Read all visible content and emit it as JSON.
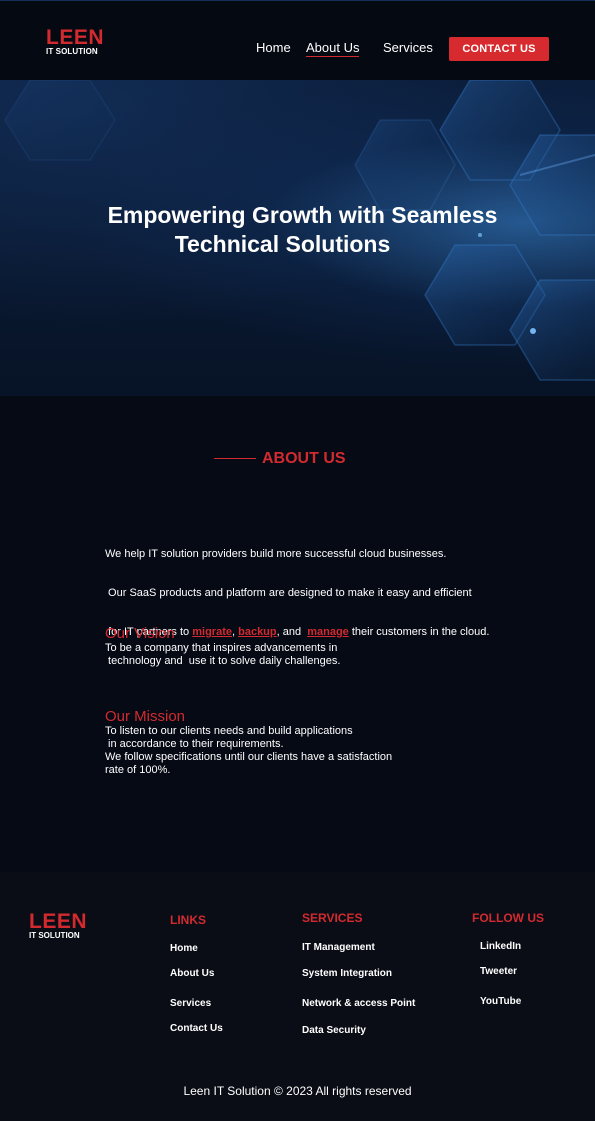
{
  "header": {
    "logo_main": "LEEN",
    "logo_sub": "IT SOLUTION",
    "nav": [
      "Home",
      "About Us",
      "Services"
    ],
    "contact_button": "CONTACT US"
  },
  "hero": {
    "title_line1": "Empowering Growth with Seamless",
    "title_line2": "Technical Solutions"
  },
  "about": {
    "heading": "ABOUT US",
    "line1": "We help IT solution providers build more successful cloud businesses.",
    "line2": " Our SaaS products and platform are designed to make it easy and efficient",
    "line3_prefix": " for IT partners to ",
    "link_migrate": "migrate",
    "sep1": ", ",
    "link_backup": "backup",
    "sep2": ", and  ",
    "link_manage": "manage",
    "line3_suffix": " their customers in the cloud."
  },
  "vision": {
    "title": "Our Vision",
    "text": "To be a company that inspires advancements in\n technology and  use it to solve daily challenges."
  },
  "mission": {
    "title": "Our Mission",
    "text": "To listen to our clients needs and build applications\n in accordance to their requirements.\nWe follow specifications until our clients have a satisfaction\nrate of 100%."
  },
  "footer": {
    "logo_main": "LEEN",
    "logo_sub": "IT SOLUTION",
    "links_heading": "LINKS",
    "links": [
      "Home",
      "About Us",
      "Services",
      "Contact Us"
    ],
    "services_heading": "SERVICES",
    "services": [
      "IT Management",
      "System Integration",
      "Network & access Point",
      "Data Security"
    ],
    "follow_heading": "FOLLOW US",
    "follow": [
      "LinkedIn",
      "Tweeter",
      "YouTube"
    ],
    "copyright": "Leen IT Solution © 2023 All rights reserved"
  },
  "colors": {
    "accent": "#d22a2f",
    "background": "#060a15",
    "footer_bg": "#0a0d15"
  }
}
